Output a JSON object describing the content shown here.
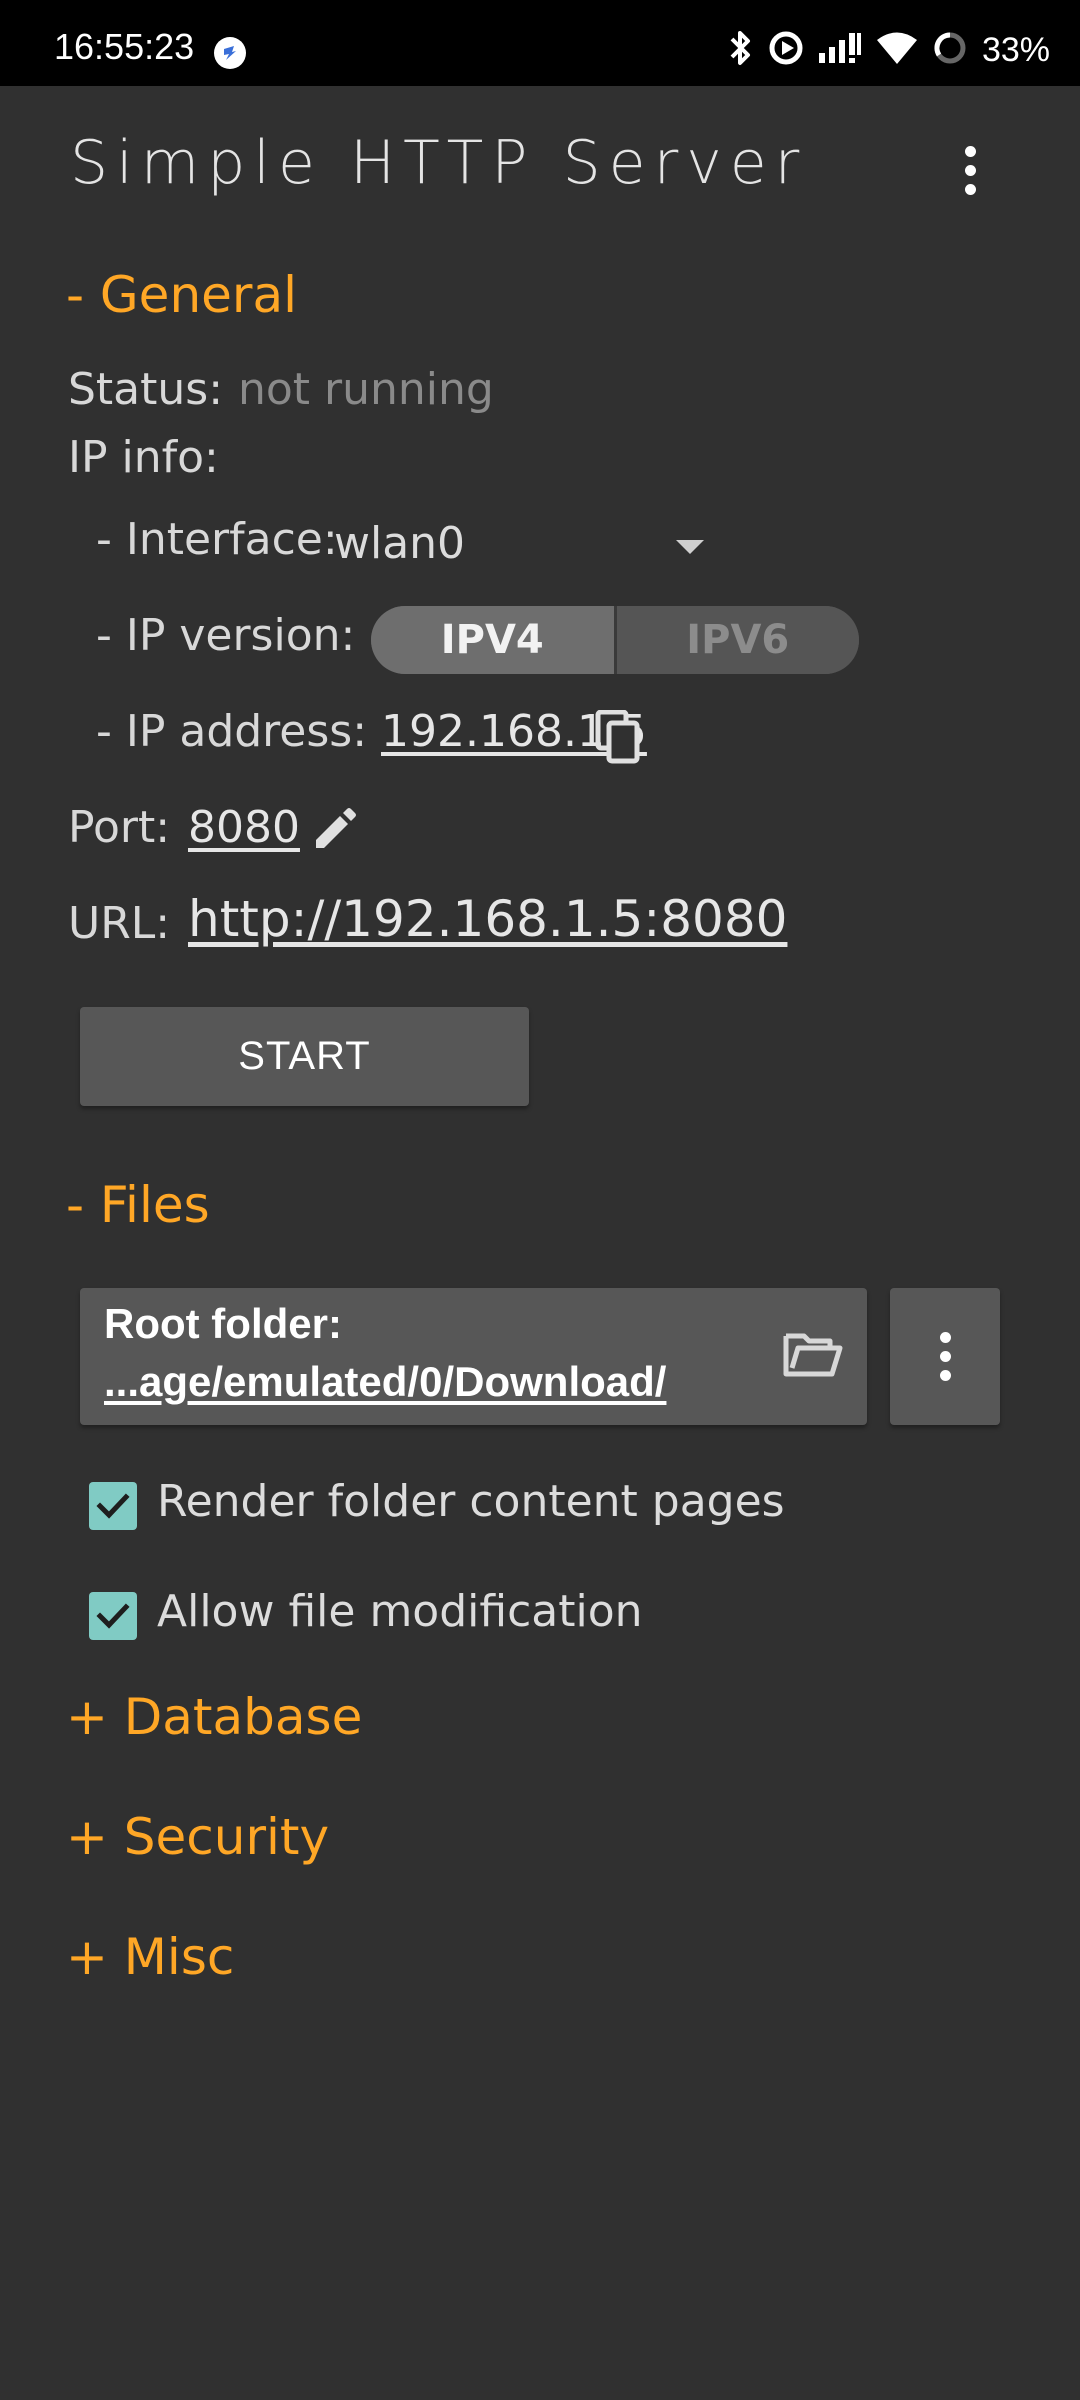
{
  "status_bar": {
    "time": "16:55:23",
    "battery": "33%"
  },
  "app_bar": {
    "title": "Simple HTTP Server"
  },
  "general": {
    "header": "- General",
    "status_label": "Status:",
    "status_value": "not running",
    "ip_info_label": "IP info:",
    "interface_label": "- Interface:",
    "interface_value": "wlan0",
    "ip_version_label": "- IP version:",
    "ip_versions": [
      "IPV4",
      "IPV6"
    ],
    "ip_version_selected": "IPV4",
    "ip_address_label": "- IP address:",
    "ip_address_value": "192.168.1.5",
    "port_label": "Port:",
    "port_value": "8080",
    "url_label": "URL:",
    "url_value": "http://192.168.1.5:8080",
    "start_button": "START"
  },
  "files": {
    "header": "- Files",
    "root_folder_label": "Root folder:",
    "root_folder_path": "...age/emulated/0/Download/",
    "render_folder_label": "Render folder content pages",
    "render_folder_checked": true,
    "allow_modification_label": "Allow file modification",
    "allow_modification_checked": true
  },
  "collapsed_sections": {
    "database": "+ Database",
    "security": "+ Security",
    "misc": "+ Misc"
  },
  "colors": {
    "accent": "#ffa726",
    "background": "#303030",
    "checkbox": "#80cbc4"
  }
}
